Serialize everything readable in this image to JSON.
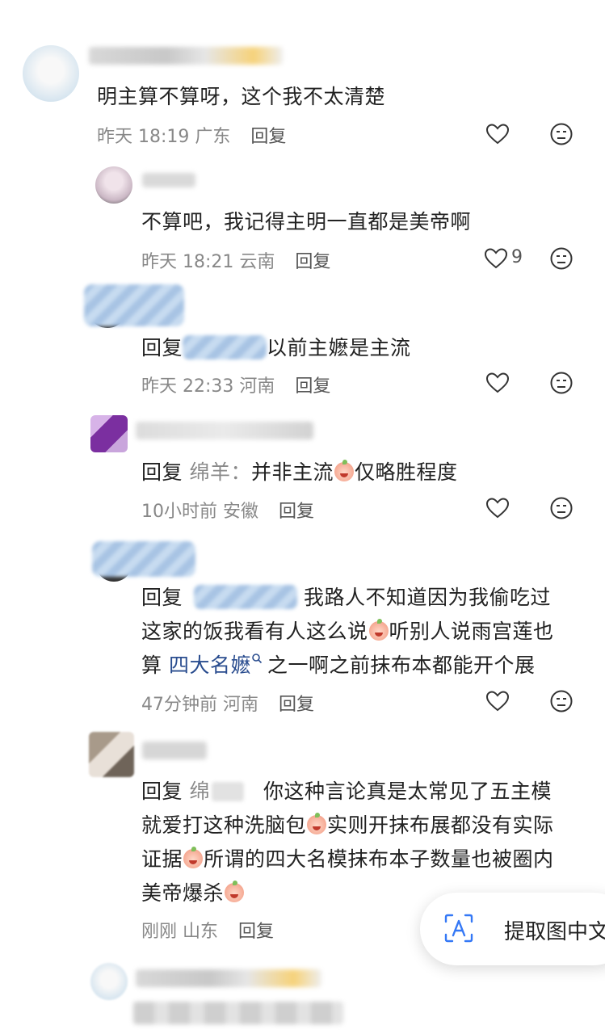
{
  "comments": [
    {
      "text": "明主算不算呀，这个我不太清楚",
      "time": "昨天 18:19",
      "location": "广东",
      "reply_label": "回复",
      "likes": ""
    },
    {
      "text": "不算吧，我记得主明一直都是美帝啊",
      "time": "昨天 18:21",
      "location": "云南",
      "reply_label": "回复",
      "likes": "9"
    },
    {
      "reply_prefix": "回复",
      "text": "以前主嬷是主流",
      "time": "昨天 22:33",
      "location": "河南",
      "reply_label": "回复"
    },
    {
      "reply_prefix": "回复",
      "mention": "绵羊：",
      "text_a": "并非主流",
      "text_b": "仅略胜程度",
      "time": "10小时前",
      "location": "安徽",
      "reply_label": "回复"
    },
    {
      "reply_prefix": "回复",
      "line1": "我路人不知道因为我偷吃过",
      "line2a": "这家的饭我看有人这么说",
      "line2b": "听别人说雨宫莲也",
      "line3a": "算",
      "link": "四大名嬷",
      "line3b": "之一啊之前抹布本都能开个展",
      "time": "47分钟前",
      "location": "河南",
      "reply_label": "回复"
    },
    {
      "reply_prefix": "回复",
      "mention": "绵",
      "line1": "你这种言论真是太常见了五主模",
      "line2a": "就爱打这种洗脑包",
      "line2b": "实则开抹布展都没有实际",
      "line3a": "证据",
      "line3b": "所谓的四大名模抹布本子数量也被圈内",
      "line4": "美帝爆杀",
      "time": "刚刚",
      "location": "山东",
      "reply_label": "回复"
    }
  ],
  "ocr_button": {
    "label": "提取图中文",
    "icon": "text-recognition-icon"
  },
  "icons": {
    "like": "heart-icon",
    "dislike": "meh-face-icon",
    "link": "search-hint-icon"
  },
  "colors": {
    "link": "#2a4d8f",
    "muted": "#888888",
    "accent_blue": "#3478f6"
  }
}
